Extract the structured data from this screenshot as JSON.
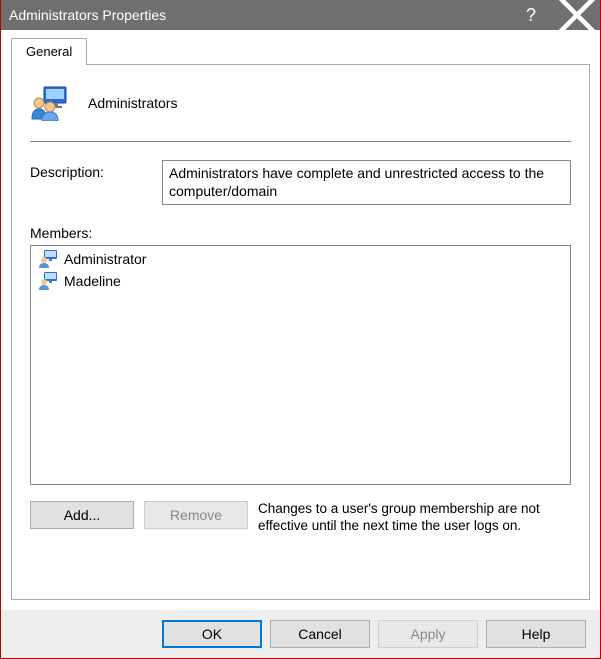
{
  "window": {
    "title": "Administrators Properties"
  },
  "tabs": {
    "general": "General"
  },
  "group": {
    "name": "Administrators",
    "description_label": "Description:",
    "description": "Administrators have complete and unrestricted access to the computer/domain",
    "members_label": "Members:",
    "members": [
      {
        "name": "Administrator"
      },
      {
        "name": "Madeline"
      }
    ]
  },
  "buttons": {
    "add": "Add...",
    "remove": "Remove",
    "ok": "OK",
    "cancel": "Cancel",
    "apply": "Apply",
    "help": "Help"
  },
  "note": "Changes to a user's group membership are not effective until the next time the user logs on."
}
